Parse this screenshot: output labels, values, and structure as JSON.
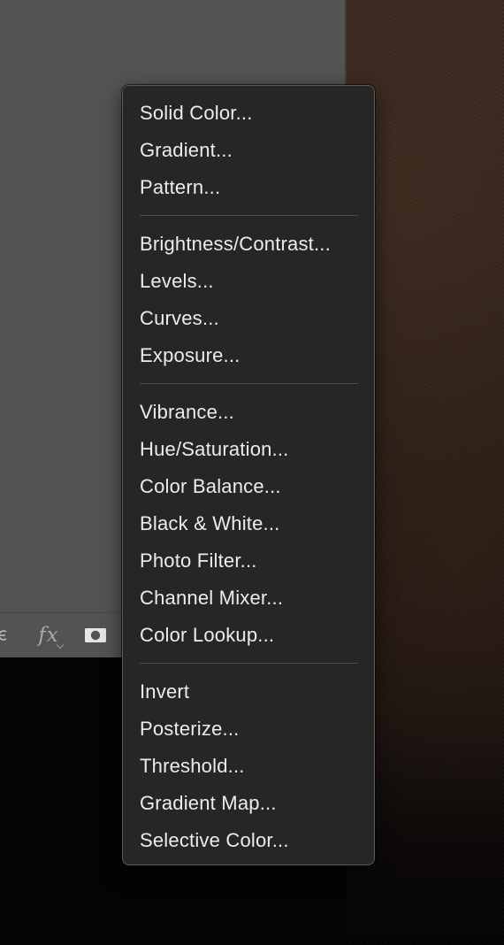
{
  "colors": {
    "panel_bg": "#535353",
    "menu_bg": "#262626",
    "menu_text": "#ececec",
    "separator": "#4e4e4e",
    "doc_image": "#34251d"
  },
  "layers_panel": {
    "footer": {
      "link_icon": "link-icon",
      "fx_label": "fx",
      "mask_icon": "add-mask-icon"
    }
  },
  "menu": {
    "groups": [
      [
        "Solid Color...",
        "Gradient...",
        "Pattern..."
      ],
      [
        "Brightness/Contrast...",
        "Levels...",
        "Curves...",
        "Exposure..."
      ],
      [
        "Vibrance...",
        "Hue/Saturation...",
        "Color Balance...",
        "Black & White...",
        "Photo Filter...",
        "Channel Mixer...",
        "Color Lookup..."
      ],
      [
        "Invert",
        "Posterize...",
        "Threshold...",
        "Gradient Map...",
        "Selective Color..."
      ]
    ]
  }
}
